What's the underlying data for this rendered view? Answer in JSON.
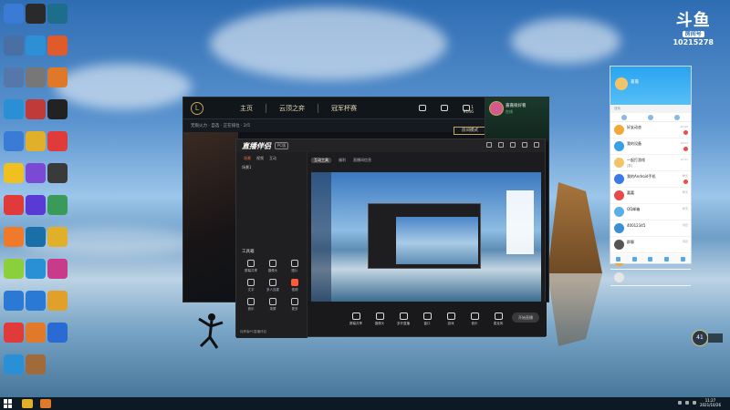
{
  "desktop": {
    "icons": [
      {
        "name": "desktop-icon-1",
        "label": "",
        "color": "#3a7bd5",
        "glyph": ""
      },
      {
        "name": "desktop-icon-2",
        "label": "",
        "color": "#2a2a2a",
        "glyph": ""
      },
      {
        "name": "desktop-icon-3",
        "label": "",
        "color": "#1c6e8c",
        "glyph": ""
      },
      {
        "name": "desktop-icon-4",
        "label": "",
        "color": "#4a6fa5",
        "glyph": ""
      },
      {
        "name": "desktop-icon-5",
        "label": "",
        "color": "#2d8fd5",
        "glyph": ""
      },
      {
        "name": "desktop-icon-6",
        "label": "",
        "color": "#e05a2a",
        "glyph": ""
      },
      {
        "name": "desktop-icon-7",
        "label": "",
        "color": "#5577aa",
        "glyph": ""
      },
      {
        "name": "desktop-icon-8",
        "label": "",
        "color": "#777",
        "glyph": ""
      },
      {
        "name": "desktop-icon-9",
        "label": "",
        "color": "#e0782a",
        "glyph": ""
      },
      {
        "name": "desktop-icon-10",
        "label": "",
        "color": "#2a90d5",
        "glyph": ""
      },
      {
        "name": "desktop-icon-11",
        "label": "",
        "color": "#c03a3a",
        "glyph": ""
      },
      {
        "name": "desktop-icon-12",
        "label": "",
        "color": "#222",
        "glyph": ""
      },
      {
        "name": "desktop-icon-13",
        "label": "",
        "color": "#3a7bd5",
        "glyph": ""
      },
      {
        "name": "desktop-icon-14",
        "label": "",
        "color": "#e0b02a",
        "glyph": ""
      },
      {
        "name": "desktop-icon-15",
        "label": "",
        "color": "#e03a3a",
        "glyph": ""
      },
      {
        "name": "desktop-icon-16",
        "label": "",
        "color": "#f0c020",
        "glyph": ""
      },
      {
        "name": "desktop-icon-17",
        "label": "",
        "color": "#7a4ad5",
        "glyph": ""
      },
      {
        "name": "desktop-icon-18",
        "label": "",
        "color": "#3a3a3a",
        "glyph": ""
      },
      {
        "name": "desktop-icon-19",
        "label": "",
        "color": "#e03a3a",
        "glyph": ""
      },
      {
        "name": "desktop-icon-20",
        "label": "",
        "color": "#5a3ad5",
        "glyph": ""
      },
      {
        "name": "desktop-icon-21",
        "label": "",
        "color": "#3a9a5a",
        "glyph": ""
      },
      {
        "name": "desktop-icon-22",
        "label": "",
        "color": "#f07a2a",
        "glyph": ""
      },
      {
        "name": "desktop-icon-23",
        "label": "",
        "color": "#1b6fa8",
        "glyph": ""
      },
      {
        "name": "desktop-icon-24",
        "label": "",
        "color": "#e0b02a",
        "glyph": ""
      },
      {
        "name": "desktop-icon-25",
        "label": "",
        "color": "#8ad03a",
        "glyph": ""
      },
      {
        "name": "desktop-icon-26",
        "label": "",
        "color": "#2a90d5",
        "glyph": ""
      },
      {
        "name": "desktop-icon-27",
        "label": "",
        "color": "#c83a8a",
        "glyph": ""
      },
      {
        "name": "desktop-icon-28",
        "label": "",
        "color": "#2a7ad5",
        "glyph": ""
      },
      {
        "name": "desktop-icon-29",
        "label": "",
        "color": "#2a7ad5",
        "glyph": ""
      },
      {
        "name": "desktop-icon-30",
        "label": "",
        "color": "#e0a02a",
        "glyph": ""
      },
      {
        "name": "desktop-icon-31",
        "label": "",
        "color": "#e03a3a",
        "glyph": ""
      },
      {
        "name": "desktop-icon-32",
        "label": "",
        "color": "#e07a2a",
        "glyph": ""
      },
      {
        "name": "desktop-icon-33",
        "label": "",
        "color": "#2a6ad5",
        "glyph": ""
      },
      {
        "name": "desktop-icon-34",
        "label": "",
        "color": "#2a90d5",
        "glyph": ""
      },
      {
        "name": "desktop-icon-35",
        "label": "",
        "color": "#a06a3a",
        "glyph": ""
      }
    ]
  },
  "douyu_badge": {
    "logo": "斗鱼",
    "sub": "房间号",
    "room": "10215278"
  },
  "lol_client": {
    "tabs": [
      "主页",
      "云顶之弈",
      "冠军杯赛"
    ],
    "subbar": "无限火力 · 自选 · 正在排位 · 2/5",
    "mode_button": "房间模式",
    "coins_top": "1",
    "coins_bottom": "9146",
    "profile_name": "嘉嘉很好看",
    "profile_status": "在线"
  },
  "helper": {
    "logo": "直播伴侣",
    "badge": "PC版",
    "menu": [
      "场景",
      "视频",
      "互动"
    ],
    "scene_label": "场景1",
    "section_title": "工具箱",
    "tools": [
      "屏幕共享",
      "摄像头",
      "图片",
      "文字",
      "多人连麦",
      "视频",
      "音乐",
      "录屏",
      "更多"
    ],
    "hot_index": 5,
    "footer": "纯享版PC直播伴侣",
    "tabs": [
      "互动工具",
      "福利",
      "直播间信息"
    ],
    "bottom_tools": [
      "屏幕共享",
      "摄像头",
      "多开直播",
      "窗口",
      "游戏",
      "音乐",
      "麦克风"
    ],
    "start_label": "开始直播"
  },
  "qq": {
    "name": "嘉嘉",
    "search_placeholder": "搜索",
    "items": [
      {
        "name": "好友动态",
        "msg": "",
        "time": "16:09",
        "color": "#f2a93a",
        "badge": true
      },
      {
        "name": "我的设备",
        "msg": "",
        "time": "16:04",
        "color": "#3aa0e6",
        "badge": true
      },
      {
        "name": "一起打游戏",
        "msg": "[群]",
        "time": "12:31",
        "color": "#f2c46a",
        "badge": false
      },
      {
        "name": "我的Android手机",
        "msg": "",
        "time": "昨天",
        "color": "#3a7ae6",
        "badge": true
      },
      {
        "name": "嘉嘉",
        "msg": "",
        "time": "昨天",
        "color": "#e64a4a",
        "badge": false
      },
      {
        "name": "QQ邮箱",
        "msg": "",
        "time": "昨天",
        "color": "#5ab0e6",
        "badge": false
      },
      {
        "name": "40012345",
        "msg": "",
        "time": "周四",
        "color": "#3a90d5",
        "badge": false
      },
      {
        "name": "群聊",
        "msg": "",
        "time": "周四",
        "color": "#555",
        "badge": false
      },
      {
        "name": "验证消息",
        "msg": "",
        "time": "周三",
        "color": "#f2a93a",
        "badge": false
      },
      {
        "name": "",
        "msg": "",
        "time": "",
        "color": "#e6e6e6",
        "badge": false
      }
    ]
  },
  "perf_widget": {
    "value": "41"
  },
  "taskbar": {
    "time": "11:27",
    "date": "2021/10/26"
  }
}
